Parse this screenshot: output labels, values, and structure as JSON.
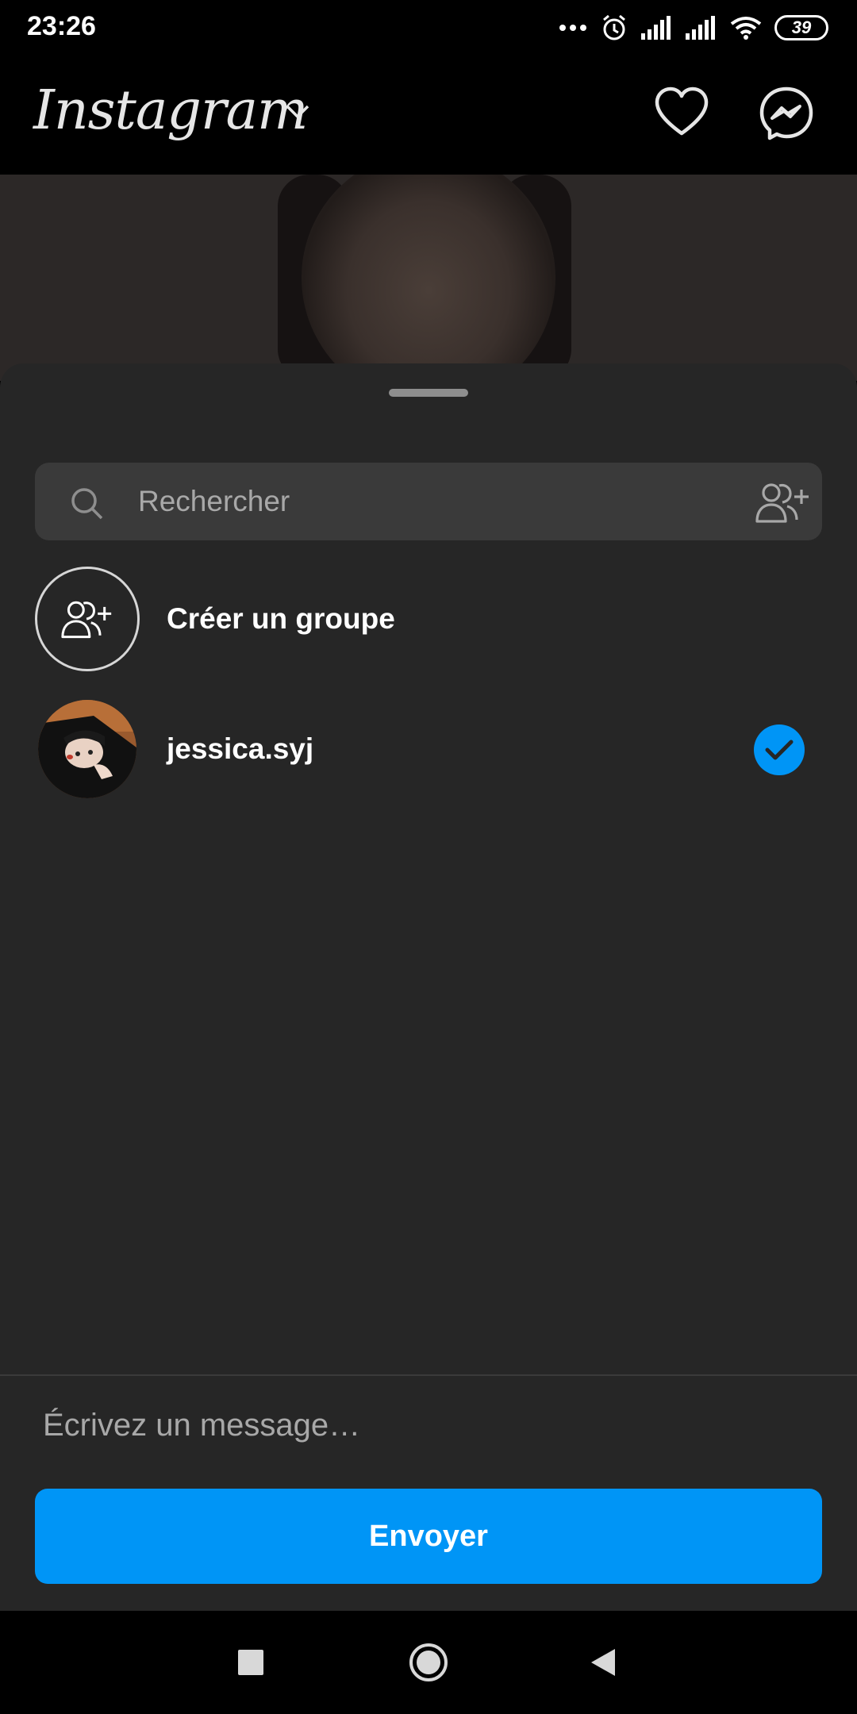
{
  "status_bar": {
    "time": "23:26",
    "battery": "39",
    "icons": [
      "more-dots-icon",
      "alarm-icon",
      "signal-icon",
      "signal-icon",
      "wifi-icon",
      "battery-icon"
    ]
  },
  "header": {
    "logo": "Instagram",
    "icons": [
      "chevron-down-icon",
      "heart-icon",
      "messenger-icon"
    ]
  },
  "share_sheet": {
    "search": {
      "placeholder": "Rechercher",
      "value": ""
    },
    "create_group": {
      "label": "Créer un groupe",
      "icon": "add-people-icon"
    },
    "recipients": [
      {
        "username": "jessica.syj",
        "selected": true
      }
    ],
    "message": {
      "placeholder": "Écrivez un message…",
      "value": ""
    },
    "send_label": "Envoyer"
  },
  "colors": {
    "accent": "#0095f6",
    "sheet_background": "#262626",
    "search_background": "#3a3a3a"
  },
  "nav_bar": {
    "icons": [
      "recents-square-icon",
      "home-circle-icon",
      "back-triangle-icon"
    ]
  }
}
